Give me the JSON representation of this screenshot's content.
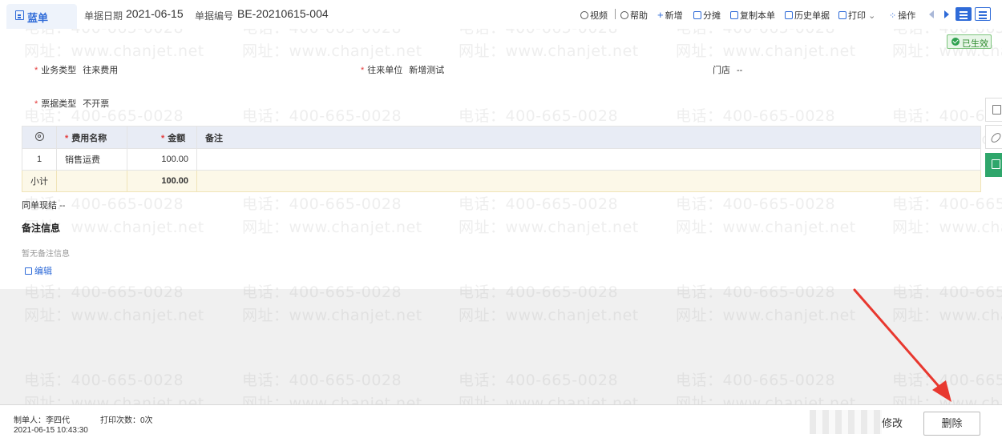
{
  "header": {
    "title": "蓝单",
    "date_label": "单据日期",
    "date_value": "2021-06-15",
    "code_label": "单据编号",
    "code_value": "BE-20210615-004"
  },
  "toolbar": {
    "video": "视频",
    "help": "帮助",
    "add": "新增",
    "split": "分摊",
    "copy": "复制本单",
    "history": "历史单据",
    "print": "打印",
    "actions": "操作"
  },
  "status_badge": "已生效",
  "form": {
    "business_type_label": "业务类型",
    "business_type_value": "往来费用",
    "partner_label": "往来单位",
    "partner_value": "新增测试",
    "store_label": "门店",
    "store_value": "--",
    "invoice_type_label": "票据类型",
    "invoice_type_value": "不开票"
  },
  "table": {
    "headers": [
      "费用名称",
      "金额",
      "备注"
    ],
    "rows": [
      {
        "no": "1",
        "name": "销售运费",
        "amount": "100.00",
        "note": ""
      }
    ],
    "subtotal_label": "小计",
    "subtotal_amount": "100.00"
  },
  "settle": {
    "label": "同单现结",
    "value": "--"
  },
  "remarks": {
    "title": "备注信息",
    "empty": "暂无备注信息",
    "edit": "编辑"
  },
  "footer": {
    "creator": "制单人：李四代",
    "print_count": "打印次数：0次",
    "created_at": "2021-06-15 10:43:30",
    "modify_button": "修改",
    "delete_button": "删除"
  },
  "watermark": {
    "phone": "电话：400-665-0028",
    "site": "网址：www.chanjet.net"
  },
  "colors": {
    "accent": "#2f6bd8",
    "required": "#e43b3b",
    "success": "#2fa14f",
    "arrow": "#e8382f"
  }
}
